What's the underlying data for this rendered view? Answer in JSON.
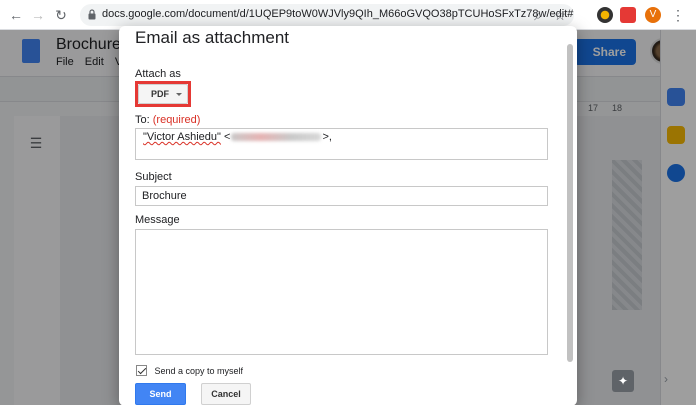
{
  "browser": {
    "url": "docs.google.com/document/d/1UQEP9toW0WJVly9QIh_M66oGVQO38pTCUHoSFxTz78w/edit#",
    "profile_initial": "V"
  },
  "docs": {
    "title": "Brochure",
    "menu": [
      "File",
      "Edit",
      "Vi"
    ],
    "share_label": "Share",
    "ruler_numbers": [
      "17",
      "18"
    ]
  },
  "dialog": {
    "title": "Email as attachment",
    "attach_label": "Attach as",
    "attach_value": "PDF",
    "to_label": "To:",
    "to_required": "(required)",
    "recipient_name": "\"Victor Ashiedu\"",
    "recipient_open": "<",
    "recipient_close": ">,",
    "subject_label": "Subject",
    "subject_value": "Brochure",
    "message_label": "Message",
    "copy_label": "Send a copy to myself",
    "send_label": "Send",
    "cancel_label": "Cancel"
  },
  "colors": {
    "highlight": "#e53935",
    "primary": "#4285f4",
    "required": "#d93025"
  },
  "icons": {
    "back": "arrow-left",
    "forward": "arrow-right",
    "reload": "reload",
    "lock": "lock",
    "zoom": "magnifier",
    "bookmark": "star"
  }
}
